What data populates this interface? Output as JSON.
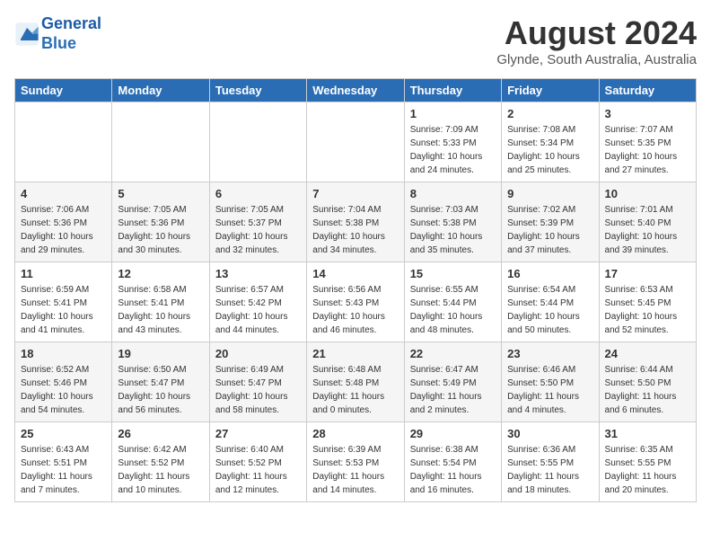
{
  "header": {
    "logo_line1": "General",
    "logo_line2": "Blue",
    "title": "August 2024",
    "location": "Glynde, South Australia, Australia"
  },
  "weekdays": [
    "Sunday",
    "Monday",
    "Tuesday",
    "Wednesday",
    "Thursday",
    "Friday",
    "Saturday"
  ],
  "weeks": [
    [
      {
        "day": "",
        "info": ""
      },
      {
        "day": "",
        "info": ""
      },
      {
        "day": "",
        "info": ""
      },
      {
        "day": "",
        "info": ""
      },
      {
        "day": "1",
        "info": "Sunrise: 7:09 AM\nSunset: 5:33 PM\nDaylight: 10 hours\nand 24 minutes."
      },
      {
        "day": "2",
        "info": "Sunrise: 7:08 AM\nSunset: 5:34 PM\nDaylight: 10 hours\nand 25 minutes."
      },
      {
        "day": "3",
        "info": "Sunrise: 7:07 AM\nSunset: 5:35 PM\nDaylight: 10 hours\nand 27 minutes."
      }
    ],
    [
      {
        "day": "4",
        "info": "Sunrise: 7:06 AM\nSunset: 5:36 PM\nDaylight: 10 hours\nand 29 minutes."
      },
      {
        "day": "5",
        "info": "Sunrise: 7:05 AM\nSunset: 5:36 PM\nDaylight: 10 hours\nand 30 minutes."
      },
      {
        "day": "6",
        "info": "Sunrise: 7:05 AM\nSunset: 5:37 PM\nDaylight: 10 hours\nand 32 minutes."
      },
      {
        "day": "7",
        "info": "Sunrise: 7:04 AM\nSunset: 5:38 PM\nDaylight: 10 hours\nand 34 minutes."
      },
      {
        "day": "8",
        "info": "Sunrise: 7:03 AM\nSunset: 5:38 PM\nDaylight: 10 hours\nand 35 minutes."
      },
      {
        "day": "9",
        "info": "Sunrise: 7:02 AM\nSunset: 5:39 PM\nDaylight: 10 hours\nand 37 minutes."
      },
      {
        "day": "10",
        "info": "Sunrise: 7:01 AM\nSunset: 5:40 PM\nDaylight: 10 hours\nand 39 minutes."
      }
    ],
    [
      {
        "day": "11",
        "info": "Sunrise: 6:59 AM\nSunset: 5:41 PM\nDaylight: 10 hours\nand 41 minutes."
      },
      {
        "day": "12",
        "info": "Sunrise: 6:58 AM\nSunset: 5:41 PM\nDaylight: 10 hours\nand 43 minutes."
      },
      {
        "day": "13",
        "info": "Sunrise: 6:57 AM\nSunset: 5:42 PM\nDaylight: 10 hours\nand 44 minutes."
      },
      {
        "day": "14",
        "info": "Sunrise: 6:56 AM\nSunset: 5:43 PM\nDaylight: 10 hours\nand 46 minutes."
      },
      {
        "day": "15",
        "info": "Sunrise: 6:55 AM\nSunset: 5:44 PM\nDaylight: 10 hours\nand 48 minutes."
      },
      {
        "day": "16",
        "info": "Sunrise: 6:54 AM\nSunset: 5:44 PM\nDaylight: 10 hours\nand 50 minutes."
      },
      {
        "day": "17",
        "info": "Sunrise: 6:53 AM\nSunset: 5:45 PM\nDaylight: 10 hours\nand 52 minutes."
      }
    ],
    [
      {
        "day": "18",
        "info": "Sunrise: 6:52 AM\nSunset: 5:46 PM\nDaylight: 10 hours\nand 54 minutes."
      },
      {
        "day": "19",
        "info": "Sunrise: 6:50 AM\nSunset: 5:47 PM\nDaylight: 10 hours\nand 56 minutes."
      },
      {
        "day": "20",
        "info": "Sunrise: 6:49 AM\nSunset: 5:47 PM\nDaylight: 10 hours\nand 58 minutes."
      },
      {
        "day": "21",
        "info": "Sunrise: 6:48 AM\nSunset: 5:48 PM\nDaylight: 11 hours\nand 0 minutes."
      },
      {
        "day": "22",
        "info": "Sunrise: 6:47 AM\nSunset: 5:49 PM\nDaylight: 11 hours\nand 2 minutes."
      },
      {
        "day": "23",
        "info": "Sunrise: 6:46 AM\nSunset: 5:50 PM\nDaylight: 11 hours\nand 4 minutes."
      },
      {
        "day": "24",
        "info": "Sunrise: 6:44 AM\nSunset: 5:50 PM\nDaylight: 11 hours\nand 6 minutes."
      }
    ],
    [
      {
        "day": "25",
        "info": "Sunrise: 6:43 AM\nSunset: 5:51 PM\nDaylight: 11 hours\nand 7 minutes."
      },
      {
        "day": "26",
        "info": "Sunrise: 6:42 AM\nSunset: 5:52 PM\nDaylight: 11 hours\nand 10 minutes."
      },
      {
        "day": "27",
        "info": "Sunrise: 6:40 AM\nSunset: 5:52 PM\nDaylight: 11 hours\nand 12 minutes."
      },
      {
        "day": "28",
        "info": "Sunrise: 6:39 AM\nSunset: 5:53 PM\nDaylight: 11 hours\nand 14 minutes."
      },
      {
        "day": "29",
        "info": "Sunrise: 6:38 AM\nSunset: 5:54 PM\nDaylight: 11 hours\nand 16 minutes."
      },
      {
        "day": "30",
        "info": "Sunrise: 6:36 AM\nSunset: 5:55 PM\nDaylight: 11 hours\nand 18 minutes."
      },
      {
        "day": "31",
        "info": "Sunrise: 6:35 AM\nSunset: 5:55 PM\nDaylight: 11 hours\nand 20 minutes."
      }
    ]
  ]
}
